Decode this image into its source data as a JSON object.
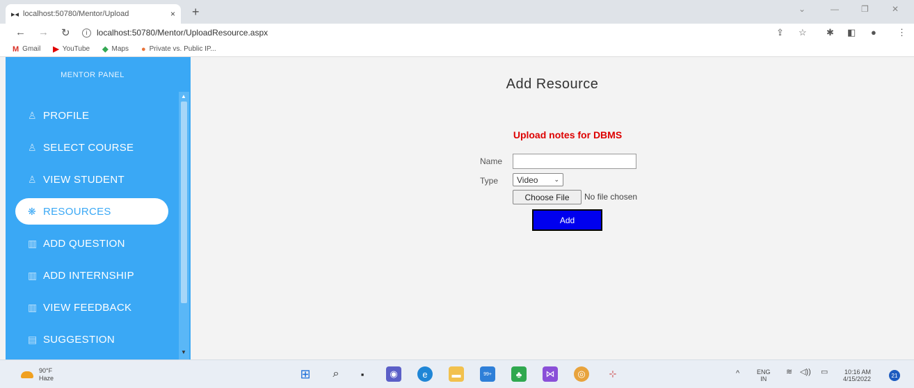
{
  "browser": {
    "tab_title": "localhost:50780/Mentor/Upload",
    "tab_close": "×",
    "new_tab": "+",
    "url": "localhost:50780/Mentor/UploadResource.aspx",
    "bookmarks": [
      {
        "label": "Gmail",
        "icon": "gmail-icon",
        "glyph": "M",
        "color": "#d93025"
      },
      {
        "label": "YouTube",
        "icon": "youtube-icon",
        "glyph": "▶",
        "color": "#e00000"
      },
      {
        "label": "Maps",
        "icon": "maps-icon",
        "glyph": "◆",
        "color": "#34a853"
      },
      {
        "label": "Private vs. Public IP...",
        "icon": "site-favicon",
        "glyph": "●",
        "color": "#e8743b"
      }
    ]
  },
  "sidebar": {
    "title": "MENTOR PANEL",
    "items": [
      {
        "label": "PROFILE",
        "icon": "user-icon",
        "glyph": "♙",
        "active": false
      },
      {
        "label": "SELECT COURSE",
        "icon": "user-icon",
        "glyph": "♙",
        "active": false
      },
      {
        "label": "VIEW STUDENT",
        "icon": "user-icon",
        "glyph": "♙",
        "active": false
      },
      {
        "label": "RESOURCES",
        "icon": "atom-icon",
        "glyph": "❋",
        "active": true
      },
      {
        "label": "ADD QUESTION",
        "icon": "map-icon",
        "glyph": "▥",
        "active": false
      },
      {
        "label": "ADD INTERNSHIP",
        "icon": "map-icon",
        "glyph": "▥",
        "active": false
      },
      {
        "label": "VIEW FEEDBACK",
        "icon": "map-icon",
        "glyph": "▥",
        "active": false
      },
      {
        "label": "SUGGESTION",
        "icon": "document-icon",
        "glyph": "▤",
        "active": false
      }
    ]
  },
  "main": {
    "title": "Add Resource",
    "subtitle": "Upload notes for DBMS",
    "name_label": "Name",
    "name_value": "",
    "type_label": "Type",
    "type_selected": "Video",
    "choose_file_label": "Choose File",
    "file_status": "No file chosen",
    "add_label": "Add"
  },
  "taskbar": {
    "weather_temp": "90°F",
    "weather_desc": "Haze",
    "language": "ENG",
    "region": "IN",
    "time": "10:16 AM",
    "date": "4/15/2022",
    "notifications": "21",
    "badge": "99+"
  }
}
